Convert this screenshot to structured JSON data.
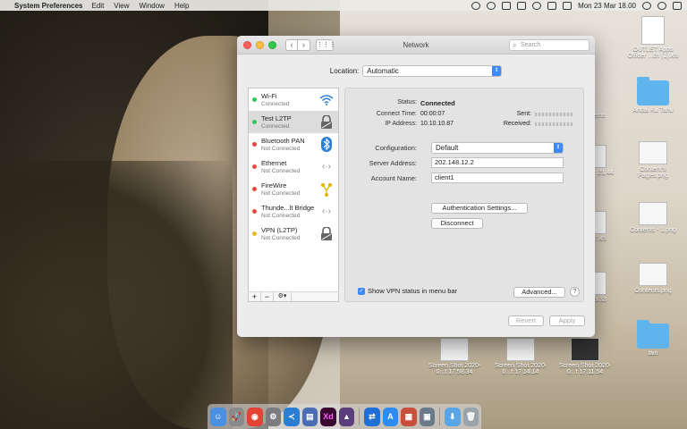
{
  "menubar": {
    "apple": "",
    "app_name": "System Preferences",
    "items": [
      "Edit",
      "View",
      "Window",
      "Help"
    ],
    "clock": "Mon 23 Mar  18.00"
  },
  "desktop": {
    "icons": [
      {
        "label": "OUTLET Apps Officer ...ch (1).xls",
        "kind": "doc"
      },
      {
        "label": "Andai Ku Tahu",
        "kind": "folder"
      },
      {
        "label": "Content's Pages.png",
        "kind": "thumb"
      },
      {
        "label": "Contents - 1.png",
        "kind": "thumb"
      },
      {
        "label": "Contents.png",
        "kind": "thumb"
      },
      {
        "label": "lain",
        "kind": "folder"
      },
      {
        "label": "Items",
        "kind": "none"
      },
      {
        "label": "Shot .21.44",
        "kind": "thumb"
      },
      {
        "label": ".17.45",
        "kind": "thumb"
      },
      {
        "label": ".09.33",
        "kind": "thumb"
      },
      {
        "label": "Screen Shot 2020-0...t 17.58.34",
        "kind": "thumb"
      },
      {
        "label": "Screen Shot 2020-0...t 17.14.14",
        "kind": "thumb"
      },
      {
        "label": "Screen Shot 2020-0...t 17.11.54",
        "kind": "thumb"
      }
    ]
  },
  "window": {
    "title": "Network",
    "search_placeholder": "Search",
    "location_label": "Location:",
    "location_value": "Automatic",
    "services": [
      {
        "name": "Wi-Fi",
        "status": "Connected",
        "dot": "#35c659",
        "icon": "wifi-icon"
      },
      {
        "name": "Test L2TP",
        "status": "Connected",
        "dot": "#35c659",
        "icon": "vpn-lock-icon"
      },
      {
        "name": "Bluetooth PAN",
        "status": "Not Connected",
        "dot": "#e9473c",
        "icon": "bluetooth-icon"
      },
      {
        "name": "Ethernet",
        "status": "Not Connected",
        "dot": "#e9473c",
        "icon": "ethernet-icon"
      },
      {
        "name": "FireWire",
        "status": "Not Connected",
        "dot": "#e9473c",
        "icon": "firewire-icon"
      },
      {
        "name": "Thunde...lt Bridge",
        "status": "Not Connected",
        "dot": "#e9473c",
        "icon": "thunderbolt-bridge-icon"
      },
      {
        "name": "VPN (L2TP)",
        "status": "Not Connected",
        "dot": "#e7b929",
        "icon": "vpn-lock-icon"
      }
    ],
    "tools": {
      "add": "+",
      "remove": "−",
      "gear": "⚙▾"
    },
    "detail": {
      "status_label": "Status:",
      "status_value": "Connected",
      "connect_time_label": "Connect Time:",
      "connect_time_value": "00:00:07",
      "ip_label": "IP Address:",
      "ip_value": "10.10.10.87",
      "sent_label": "Sent:",
      "received_label": "Received:",
      "configuration_label": "Configuration:",
      "configuration_value": "Default",
      "server_label": "Server Address:",
      "server_value": "202.148.12.2",
      "account_label": "Account Name:",
      "account_value": "client1",
      "auth_button": "Authentication Settings...",
      "disconnect_button": "Disconnect",
      "show_vpn_label": "Show VPN status in menu bar",
      "advanced_button": "Advanced...",
      "help": "?"
    },
    "revert_button": "Revert",
    "apply_button": "Apply"
  },
  "dock": {
    "apps": [
      {
        "name": "finder",
        "color": "#4a8fe0",
        "glyph": "☺"
      },
      {
        "name": "launchpad",
        "color": "#8a8a8a",
        "glyph": "🚀"
      },
      {
        "name": "chrome",
        "color": "#e34234",
        "glyph": "◉"
      },
      {
        "name": "system-preferences",
        "color": "#7b7b80",
        "glyph": "⚙"
      },
      {
        "name": "vscode",
        "color": "#2a7fd4",
        "glyph": "≺"
      },
      {
        "name": "notes-app",
        "color": "#4a6db5",
        "glyph": "▤"
      },
      {
        "name": "xd",
        "color": "#3a0733",
        "glyph": "Xd"
      },
      {
        "name": "cabinet-app",
        "color": "#5a3f7c",
        "glyph": "▲"
      },
      {
        "name": "teamviewer",
        "color": "#1f6fd4",
        "glyph": "⇄"
      },
      {
        "name": "app-store",
        "color": "#2d8cf0",
        "glyph": "A"
      },
      {
        "name": "preview",
        "color": "#c94f3d",
        "glyph": "▦"
      },
      {
        "name": "photos-app",
        "color": "#6a7a88",
        "glyph": "▣"
      },
      {
        "name": "downloads-folder",
        "color": "#58a6e8",
        "glyph": "⬇"
      },
      {
        "name": "trash",
        "color": "#9aa3aa",
        "glyph": "🗑"
      }
    ]
  }
}
